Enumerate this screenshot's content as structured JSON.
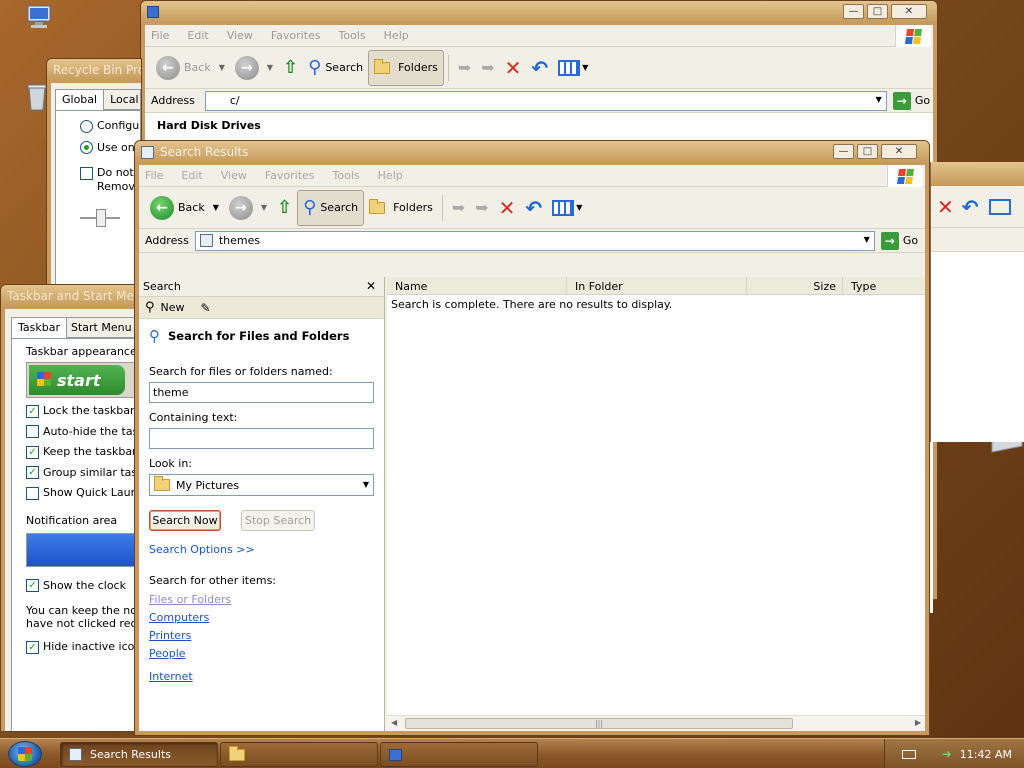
{
  "colors": {
    "desktop": "#7a4a1c",
    "title_bar": "#c59a5c",
    "link": "#1a55c6",
    "go_green": "#3a9b3a",
    "delete_red": "#d62d20"
  },
  "desktop": {
    "icons": [
      {
        "name": "computer-icon"
      },
      {
        "name": "recycle-bin-icon"
      },
      {
        "name": "cd-drive-icon"
      }
    ]
  },
  "back_window": {
    "menu": [
      "File",
      "Edit",
      "View",
      "Favorites",
      "Tools",
      "Help"
    ],
    "toolbar": {
      "back": "Back",
      "search": "Search",
      "folders": "Folders"
    },
    "address_label": "Address",
    "address_value": "c/",
    "go": "Go",
    "section": "Hard Disk Drives"
  },
  "recycle_dialog": {
    "title": "Recycle Bin Properties",
    "tabs": [
      "Global",
      "Local Di"
    ],
    "options": [
      "Configure",
      "Use one",
      "Do not m",
      "Remove"
    ]
  },
  "taskbar_dialog": {
    "title": "Taskbar and Start Menu",
    "tabs": [
      "Taskbar",
      "Start Menu"
    ],
    "appearance_label": "Taskbar appearance",
    "start_preview": "start",
    "checks": [
      {
        "label": "Lock the taskbar",
        "checked": true
      },
      {
        "label": "Auto-hide the task",
        "checked": false
      },
      {
        "label": "Keep the taskbar",
        "checked": true
      },
      {
        "label": "Group similar task",
        "checked": true
      },
      {
        "label": "Show Quick Laun",
        "checked": false
      }
    ],
    "notification_label": "Notification area",
    "show_clock": "Show the clock",
    "info_line1": "You can keep the no",
    "info_line2": "have not clicked rece",
    "hide_inactive": "Hide inactive icon"
  },
  "search_window": {
    "title": "Search Results",
    "menu": [
      "File",
      "Edit",
      "View",
      "Favorites",
      "Tools",
      "Help"
    ],
    "toolbar": {
      "back": "Back",
      "search": "Search",
      "folders": "Folders"
    },
    "address_label": "Address",
    "address_value": "themes",
    "go": "Go",
    "pane_title": "Search",
    "new": "New",
    "heading": "Search for Files and Folders",
    "named_label": "Search for files or folders named:",
    "named_value": "theme",
    "containing_label": "Containing text:",
    "containing_value": "",
    "lookin_label": "Look in:",
    "lookin_value": "My Pictures",
    "search_now": "Search Now",
    "stop_search": "Stop Search",
    "search_options": "Search Options >>",
    "other_label": "Search for other items:",
    "other_links": [
      "Files or Folders",
      "Computers",
      "Printers",
      "People"
    ],
    "internet": "Internet",
    "columns": [
      "Name",
      "In Folder",
      "Size",
      "Type"
    ],
    "results_message": "Search is complete. There are no results to display."
  },
  "taskbar": {
    "buttons": [
      "Search Results",
      "",
      ""
    ],
    "clock": "11:42 AM"
  }
}
